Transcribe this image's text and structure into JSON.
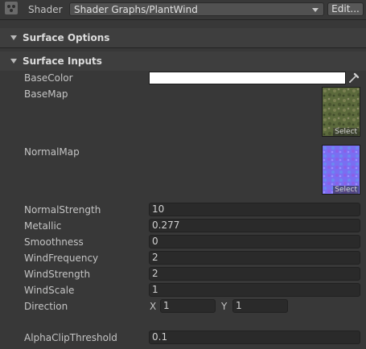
{
  "shader": {
    "label": "Shader",
    "selected": "Shader Graphs/PlantWind",
    "edit_label": "Edit..."
  },
  "sections": {
    "surface_options": "Surface Options",
    "surface_inputs": "Surface Inputs"
  },
  "props": {
    "base_color": {
      "label": "BaseColor",
      "value_color": "#ffffff"
    },
    "base_map": {
      "label": "BaseMap",
      "select_label": "Select"
    },
    "normal_map": {
      "label": "NormalMap",
      "select_label": "Select"
    },
    "normal_strength": {
      "label": "NormalStrength",
      "value": "10"
    },
    "metallic": {
      "label": "Metallic",
      "value": "0.277"
    },
    "smoothness": {
      "label": "Smoothness",
      "value": "0"
    },
    "wind_frequency": {
      "label": "WindFrequency",
      "value": "2"
    },
    "wind_strength": {
      "label": "WindStrength",
      "value": "2"
    },
    "wind_scale": {
      "label": "WindScale",
      "value": "1"
    },
    "direction": {
      "label": "Direction",
      "x_label": "X",
      "x": "1",
      "y_label": "Y",
      "y": "1"
    },
    "alpha_clip_threshold": {
      "label": "AlphaClipThreshold",
      "value": "0.1"
    }
  },
  "icons": {
    "shader_asset": "shader-icon",
    "eyedropper": "eyedropper-icon",
    "foldout": "triangle-down-icon"
  },
  "colors": {
    "background": "#383838",
    "section_bg": "#3e3e3e",
    "field_bg": "#2a2a2a",
    "text": "#c4c4c4"
  }
}
